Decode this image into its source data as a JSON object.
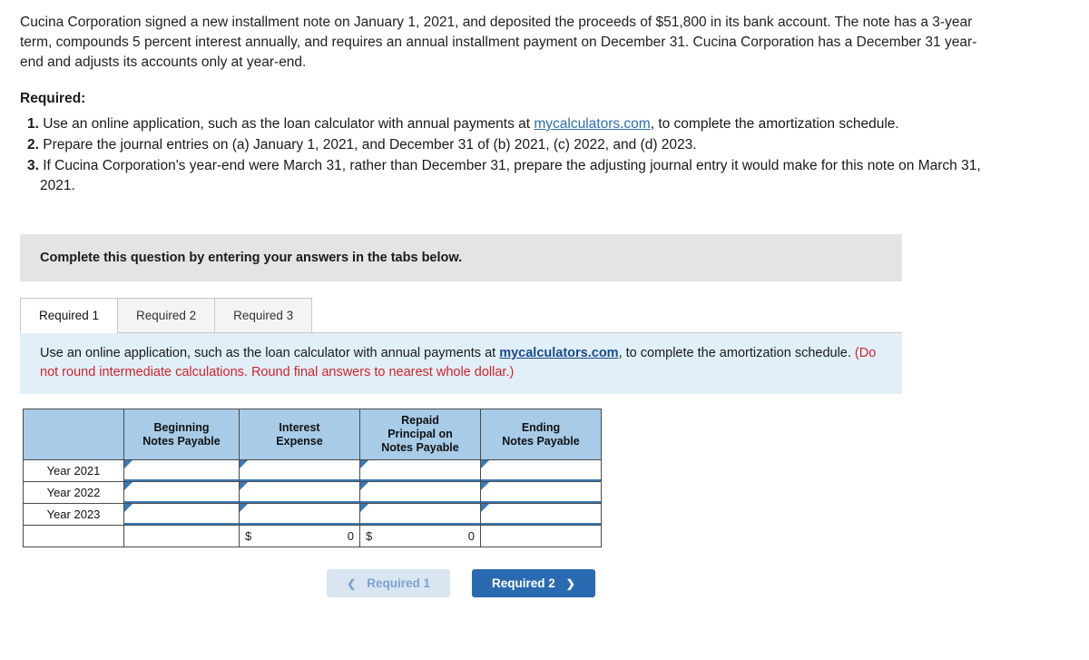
{
  "problem": {
    "paragraph": "Cucina Corporation signed a new installment note on January 1, 2021, and deposited the proceeds of $51,800 in its bank account. The note has a 3-year term, compounds 5 percent interest annually, and requires an annual installment payment on December 31. Cucina Corporation has a December 31 year-end and adjusts its accounts only at year-end.",
    "required_heading": "Required:",
    "requirements": [
      {
        "num": "1.",
        "text_before_link": "Use an online application, such as the loan calculator with annual payments at ",
        "link": "mycalculators.com",
        "text_after_link": ", to complete the amortization schedule."
      },
      {
        "num": "2.",
        "text_before_link": "Prepare the journal entries on (a) January 1, 2021, and December 31 of (b) 2021, (c) 2022, and (d) 2023.",
        "link": "",
        "text_after_link": ""
      },
      {
        "num": "3.",
        "text_before_link": "If Cucina Corporation's year-end were March 31, rather than December 31, prepare the adjusting journal entry it would make for this note on March 31, 2021.",
        "link": "",
        "text_after_link": ""
      }
    ]
  },
  "banner": {
    "text": "Complete this question by entering your answers in the tabs below."
  },
  "tabs": [
    {
      "label": "Required 1",
      "active": true
    },
    {
      "label": "Required 2",
      "active": false
    },
    {
      "label": "Required 3",
      "active": false
    }
  ],
  "instruction": {
    "part1": "Use an online application, such as the loan calculator with annual payments at ",
    "link": "mycalculators.com",
    "part2": ", to complete the amortization schedule. ",
    "note": "(Do not round intermediate calculations. Round final answers to nearest whole dollar.)"
  },
  "table": {
    "headers": [
      "",
      "Beginning\nNotes Payable",
      "Interest\nExpense",
      "Repaid\nPrincipal on\nNotes Payable",
      "Ending\nNotes Payable"
    ],
    "header_lines": {
      "col1": [
        "Beginning",
        "Notes Payable"
      ],
      "col2": [
        "Interest",
        "Expense"
      ],
      "col3": [
        "Repaid",
        "Principal on",
        "Notes Payable"
      ],
      "col4": [
        "Ending",
        "Notes Payable"
      ]
    },
    "rows": [
      {
        "label": "Year 2021",
        "beginning": "",
        "interest": "",
        "repaid": "",
        "ending": ""
      },
      {
        "label": "Year 2022",
        "beginning": "",
        "interest": "",
        "repaid": "",
        "ending": ""
      },
      {
        "label": "Year 2023",
        "beginning": "",
        "interest": "",
        "repaid": "",
        "ending": ""
      }
    ],
    "total_row": {
      "label": "",
      "beginning": "",
      "interest_symbol": "$",
      "interest_value": "0",
      "repaid_symbol": "$",
      "repaid_value": "0",
      "ending": ""
    }
  },
  "buttons": {
    "prev": {
      "label": "Required 1",
      "chevron": "chevron-left-icon"
    },
    "next": {
      "label": "Required 2",
      "chevron": "chevron-right-icon"
    }
  },
  "colors": {
    "accent": "#2a6ab0",
    "table_header": "#a8cbe8",
    "instruction_bg": "#e1eff8",
    "banner_bg": "#e4e4e4",
    "red_note": "#d0242a"
  }
}
